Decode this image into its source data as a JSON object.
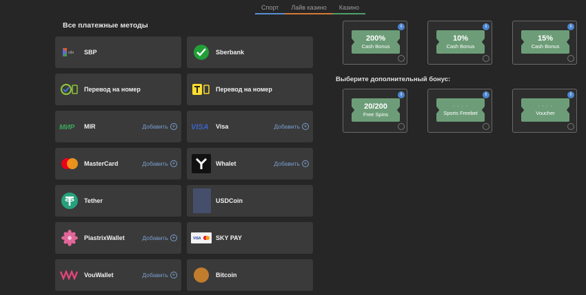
{
  "tabs": [
    {
      "label": "Спорт"
    },
    {
      "label": "Лайв казино"
    },
    {
      "label": "Казино"
    }
  ],
  "methods_title": "Все платежные методы",
  "add_label": "Добавить",
  "methods": [
    {
      "name": "SBP",
      "icon": "sbp-icon"
    },
    {
      "name": "Sberbank",
      "icon": "sberbank-icon"
    },
    {
      "name": "Перевод на номер",
      "icon": "transfer-green-icon"
    },
    {
      "name": "Перевод на номер",
      "icon": "transfer-yellow-icon"
    },
    {
      "name": "MIR",
      "icon": "mir-icon"
    },
    {
      "name": "Visa",
      "icon": "visa-icon"
    },
    {
      "name": "MasterCard",
      "icon": "mastercard-icon"
    },
    {
      "name": "Whalet",
      "icon": "whalet-icon"
    },
    {
      "name": "Tether",
      "icon": "tether-icon"
    },
    {
      "name": "USDCoin",
      "icon": "usdcoin-icon"
    },
    {
      "name": "PiastrixWallet",
      "icon": "piastrix-icon"
    },
    {
      "name": "SKY PAY",
      "icon": "skypay-icon"
    },
    {
      "name": "VouWallet",
      "icon": "vouwallet-icon"
    },
    {
      "name": "Bitcoin",
      "icon": "bitcoin-icon"
    }
  ],
  "bonuses": [
    {
      "value": "200%",
      "label": "Cash Bonus"
    },
    {
      "value": "10%",
      "label": "Cash Bonus"
    },
    {
      "value": "15%",
      "label": "Cash Bonus"
    }
  ],
  "extra_title": "Выберите дополнительный бонус:",
  "extra_bonuses": [
    {
      "value": "20/200",
      "label": "Free Spins"
    },
    {
      "value": "· · · ·",
      "label": "Sports Freebet"
    },
    {
      "value": "· · · ·",
      "label": "Voucher"
    }
  ],
  "info_glyph": "i",
  "colors": {
    "accent_green": "#6d9d78",
    "link_blue": "#7a9fd0",
    "info_blue": "#4c86cf"
  }
}
